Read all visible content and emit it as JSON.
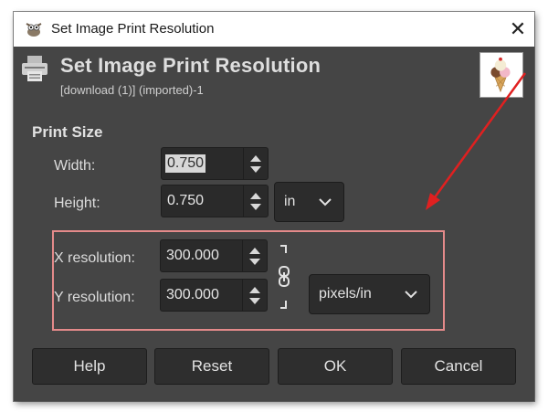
{
  "window": {
    "title": "Set Image Print Resolution",
    "close_glyph": "✕"
  },
  "header": {
    "title": "Set Image Print Resolution",
    "subtitle": "[download (1)] (imported)-1"
  },
  "print_size": {
    "label": "Print Size",
    "width": {
      "label": "Width:",
      "value": "0.750"
    },
    "height": {
      "label": "Height:",
      "value": "0.750"
    },
    "unit": "in"
  },
  "resolution": {
    "x": {
      "label": "X resolution:",
      "value": "300.000"
    },
    "y": {
      "label": "Y resolution:",
      "value": "300.000"
    },
    "unit": "pixels/in"
  },
  "buttons": {
    "help": "Help",
    "reset": "Reset",
    "ok": "OK",
    "cancel": "Cancel"
  },
  "colors": {
    "dialog_bg": "#454545",
    "annotation_red": "#e02020",
    "highlight_border": "#e48a8a"
  },
  "icons": [
    "wilber-icon",
    "close-icon",
    "printer-icon",
    "ice-cream-thumbnail",
    "spin-up-icon",
    "spin-down-icon",
    "chevron-down-icon",
    "chain-link-icon",
    "red-arrow-annotation"
  ]
}
